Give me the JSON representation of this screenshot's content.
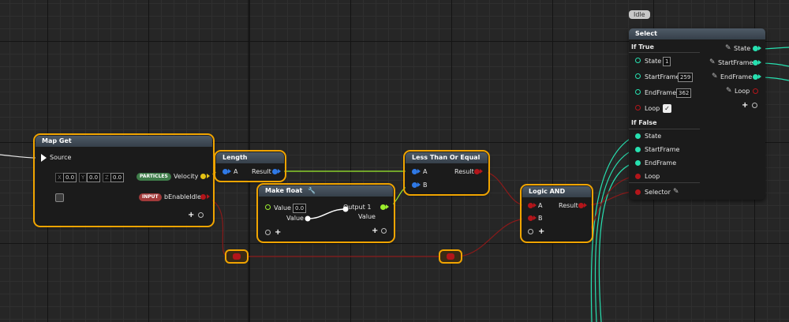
{
  "map_get": {
    "title": "Map Get",
    "source_label": "Source",
    "vec_x": "X",
    "vec_x_val": "0.0",
    "vec_y": "Y",
    "vec_y_val": "0.0",
    "vec_z": "Z",
    "vec_z_val": "0.0",
    "particles_badge": "PARTICLES",
    "velocity_label": "Velocity",
    "input_badge": "INPUT",
    "benable_label": "bEnableIdle"
  },
  "length": {
    "title": "Length",
    "a_label": "A",
    "result_label": "Result"
  },
  "make_float": {
    "title": "Make float",
    "value_label": "Value",
    "value_val": "0.0",
    "value2_label": "Value",
    "output_label": "Output 1",
    "output_value_label": "Value"
  },
  "less_than": {
    "title": "Less Than Or Equal",
    "a_label": "A",
    "b_label": "B",
    "result_label": "Result"
  },
  "logic_and": {
    "title": "Logic AND",
    "a_label": "A",
    "b_label": "B",
    "result_label": "Result"
  },
  "select": {
    "bubble": "Idle",
    "title": "Select",
    "if_true": "If True",
    "state_label": "State",
    "state_val": "1",
    "startframe_label": "StartFrame",
    "startframe_val": "259",
    "endframe_label": "EndFrame",
    "endframe_val": "362",
    "loop_label": "Loop",
    "if_false": "If False",
    "f_state": "State",
    "f_startframe": "StartFrame",
    "f_endframe": "EndFrame",
    "f_loop": "Loop",
    "selector_label": "Selector",
    "out_state": "State",
    "out_startframe": "StartFrame",
    "out_endframe": "EndFrame",
    "out_loop": "Loop"
  },
  "colors": {
    "selected_outline": "#f0a400",
    "teal_pin": "#27e0b0",
    "red_pin": "#b3151a",
    "blue_pin": "#2f79e6",
    "lime_pin": "#9cef2d"
  }
}
